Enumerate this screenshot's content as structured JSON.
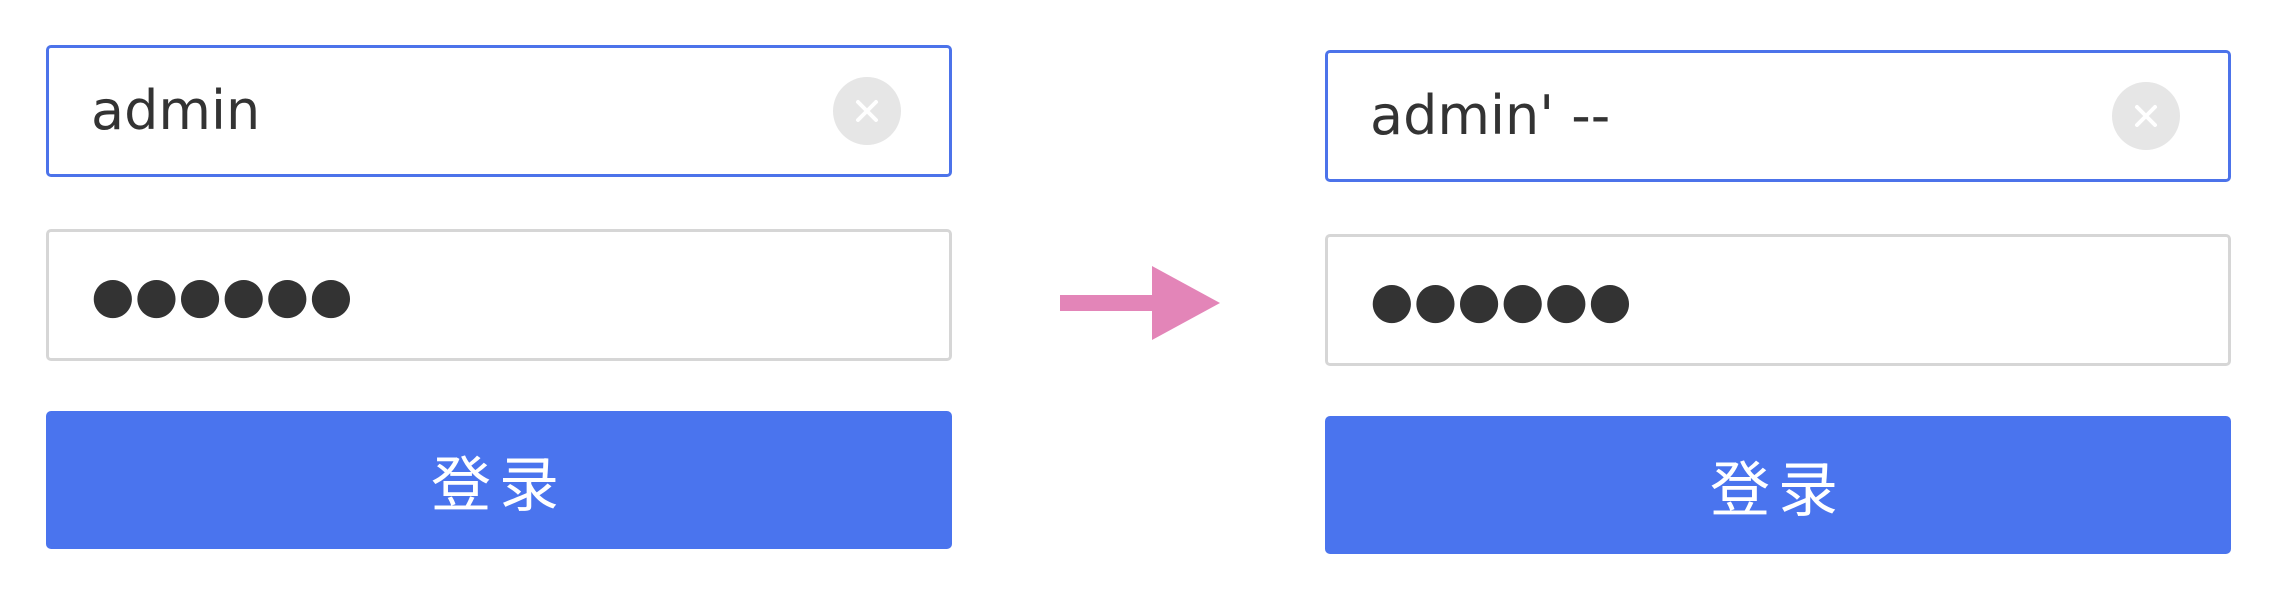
{
  "before": {
    "username": {
      "value": "admin",
      "clear_icon": "clear-circle-x"
    },
    "password": {
      "value": "●●●●●●"
    },
    "login_label": "登录"
  },
  "after": {
    "username": {
      "value": "admin' --",
      "clear_icon": "clear-circle-x"
    },
    "password": {
      "value": "●●●●●●"
    },
    "login_label": "登录"
  },
  "arrow": {
    "icon": "right-arrow",
    "color": "#e385b8"
  },
  "colors": {
    "focus_border": "#4c73ea",
    "idle_border": "#d6d6d6",
    "button": "#4a74ee",
    "text": "#333333"
  }
}
